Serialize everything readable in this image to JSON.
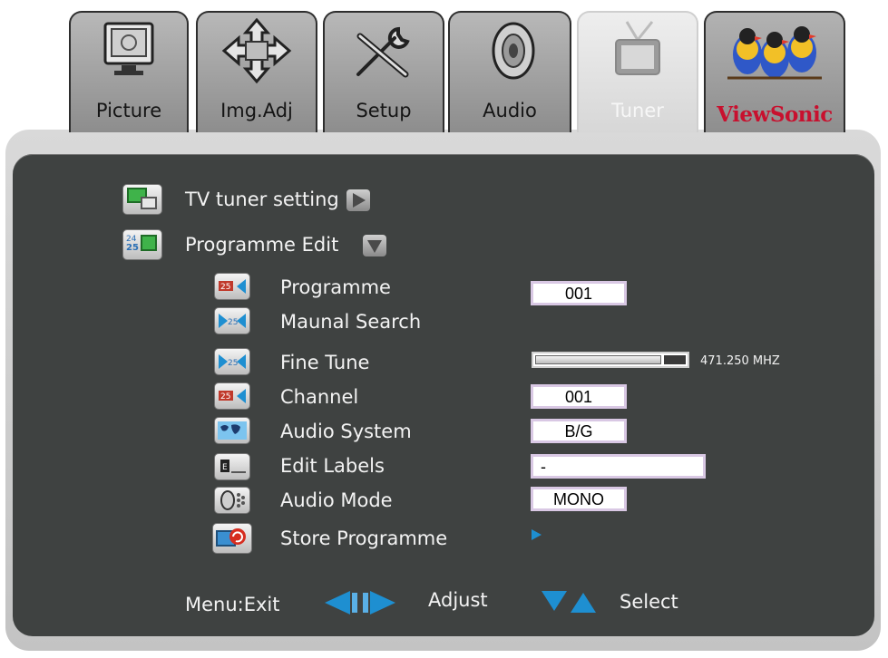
{
  "tabs": [
    {
      "label": "Picture",
      "icon": "monitor-icon"
    },
    {
      "label": "Img.Adj",
      "icon": "move-arrows-icon"
    },
    {
      "label": "Setup",
      "icon": "tools-icon"
    },
    {
      "label": "Audio",
      "icon": "speaker-icon"
    },
    {
      "label": "Tuner",
      "icon": "tv-antenna-icon",
      "active": true
    },
    {
      "label": "ViewSonic",
      "icon": "viewsonic-birds-logo"
    }
  ],
  "menu": {
    "tv_tuner_setting": "TV tuner setting",
    "programme_edit": "Programme Edit"
  },
  "items": [
    {
      "label": "Programme",
      "value": "001"
    },
    {
      "label": "Maunal Search",
      "value": ""
    },
    {
      "label": "Fine Tune",
      "value": "471.250 MHZ"
    },
    {
      "label": "Channel",
      "value": "001"
    },
    {
      "label": "Audio System",
      "value": "B/G"
    },
    {
      "label": "Edit Labels",
      "value": "-"
    },
    {
      "label": "Audio Mode",
      "value": "MONO"
    },
    {
      "label": "Store Programme",
      "value": ""
    }
  ],
  "fine_tune_level": 0.82,
  "footer": {
    "menu_exit": "Menu:Exit",
    "adjust": "Adjust",
    "select": "Select"
  },
  "colors": {
    "panel": "#3f4241",
    "accent_arrow": "#1e8fd1",
    "brand": "#c8102e",
    "value_border": "#d9c8e4"
  }
}
